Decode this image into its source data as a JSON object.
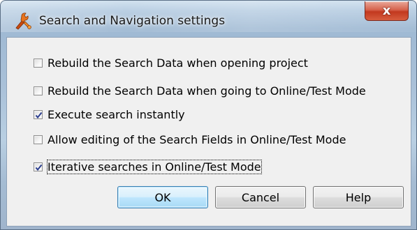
{
  "window": {
    "title": "Search and Navigation settings",
    "close_label": "x"
  },
  "options": [
    {
      "label": "Rebuild the Search Data when opening project",
      "checked": false
    },
    {
      "label": "Rebuild the Search Data when going to Online/Test Mode",
      "checked": false
    },
    {
      "label": "Execute search instantly",
      "checked": true
    },
    {
      "label": "Allow editing of the Search Fields in Online/Test Mode",
      "checked": false
    },
    {
      "label": "Iterative searches in Online/Test Mode",
      "checked": true
    }
  ],
  "buttons": {
    "ok_label": "OK",
    "cancel_label": "Cancel",
    "help_label": "Help"
  },
  "colors": {
    "titlebar": "#b7cde2",
    "client_bg": "#f0f0f0",
    "close_button": "#c2381f",
    "default_button": "#bee6fd",
    "checkmark": "#2c3f8f"
  },
  "icons": {
    "app": "orange-tools-app-icon",
    "close": "close-icon",
    "check": "checkmark-icon"
  }
}
